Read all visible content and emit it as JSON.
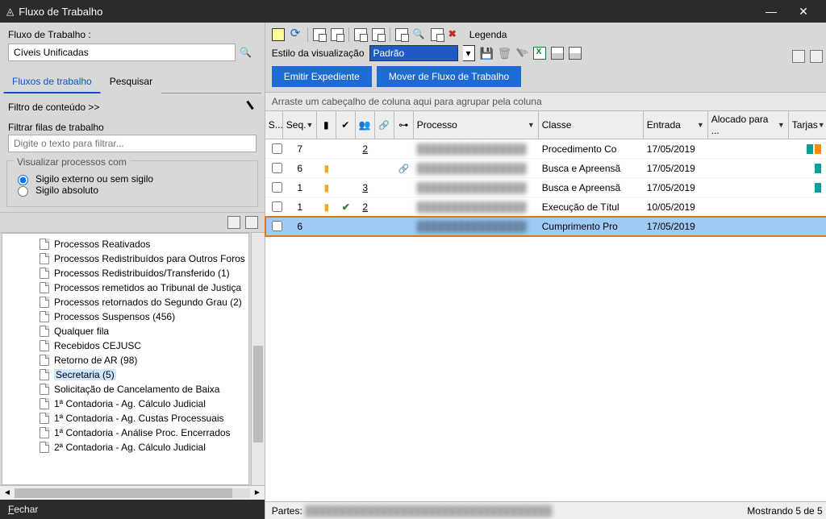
{
  "window": {
    "title": "Fluxo de Trabalho"
  },
  "left": {
    "search_label": "Fluxo de Trabalho :",
    "search_value": "Cíveis Unificadas",
    "tabs": {
      "workflow": "Fluxos de trabalho",
      "search": "Pesquisar"
    },
    "filter_header": "Filtro de conteúdo >>",
    "filter_label": "Filtrar filas de trabalho",
    "filter_placeholder": "Digite o texto para filtrar...",
    "visualize_legend": "Visualizar processos com",
    "radio_external": "Sigilo externo ou sem sigilo",
    "radio_absolute": "Sigilo absoluto",
    "tree": [
      "Processos Reativados",
      "Processos Redistribuídos para Outros Foros",
      "Processos Redistribuídos/Transferido (1)",
      "Processos remetidos ao Tribunal de Justiça",
      "Processos retornados do Segundo Grau (2)",
      "Processos Suspensos (456)",
      "Qualquer fila",
      "Recebidos CEJUSC",
      "Retorno de AR (98)",
      "Secretaria (5)",
      "Solicitação de Cancelamento de Baixa",
      "1ª Contadoria - Ag. Cálculo Judicial",
      "1ª Contadoria - Ag. Custas Processuais",
      "1ª Contadoria - Análise Proc. Encerrados",
      "2ª Contadoria - Ag. Cálculo Judicial"
    ],
    "selected_tree_index": 9,
    "close_label": "Fechar"
  },
  "right": {
    "legend_label": "Legenda",
    "visual_label": "Estilo da visualização",
    "visual_value": "Padrão",
    "btn_emit": "Emitir Expediente",
    "btn_move": "Mover de Fluxo de Trabalho",
    "group_hint": "Arraste um cabeçalho de coluna aqui para agrupar pela coluna",
    "headers": {
      "sel": "S...",
      "seq": "Seq.",
      "proc": "Processo",
      "classe": "Classe",
      "entrada": "Entrada",
      "aloc": "Alocado para ...",
      "tarjas": "Tarjas"
    },
    "rows": [
      {
        "seq": "7",
        "flag": false,
        "check": false,
        "groups": "2",
        "link": "",
        "proc": "████████████████",
        "classe": "Procedimento Co",
        "entrada": "17/05/2019",
        "tags": [
          "teal",
          "orange"
        ]
      },
      {
        "seq": "6",
        "flag": true,
        "check": false,
        "groups": "",
        "link": "link",
        "proc": "████████████████",
        "classe": "Busca e Apreensã",
        "entrada": "17/05/2019",
        "tags": [
          "teal"
        ]
      },
      {
        "seq": "1",
        "flag": true,
        "check": false,
        "groups": "3",
        "link": "",
        "proc": "████████████████",
        "classe": "Busca e Apreensã",
        "entrada": "17/05/2019",
        "tags": [
          "teal"
        ]
      },
      {
        "seq": "1",
        "flag": true,
        "check": true,
        "groups": "2",
        "link": "",
        "proc": "████████████████",
        "classe": "Execução de Títul",
        "entrada": "10/05/2019",
        "tags": []
      },
      {
        "seq": "6",
        "flag": false,
        "check": false,
        "groups": "",
        "link": "",
        "proc": "████████████████",
        "classe": "Cumprimento Pro",
        "entrada": "17/05/2019",
        "tags": [],
        "selected": true
      }
    ],
    "partes_label": "Partes:",
    "partes_value": "████████████████████████████████████",
    "footer_count": "Mostrando 5 de 5"
  }
}
